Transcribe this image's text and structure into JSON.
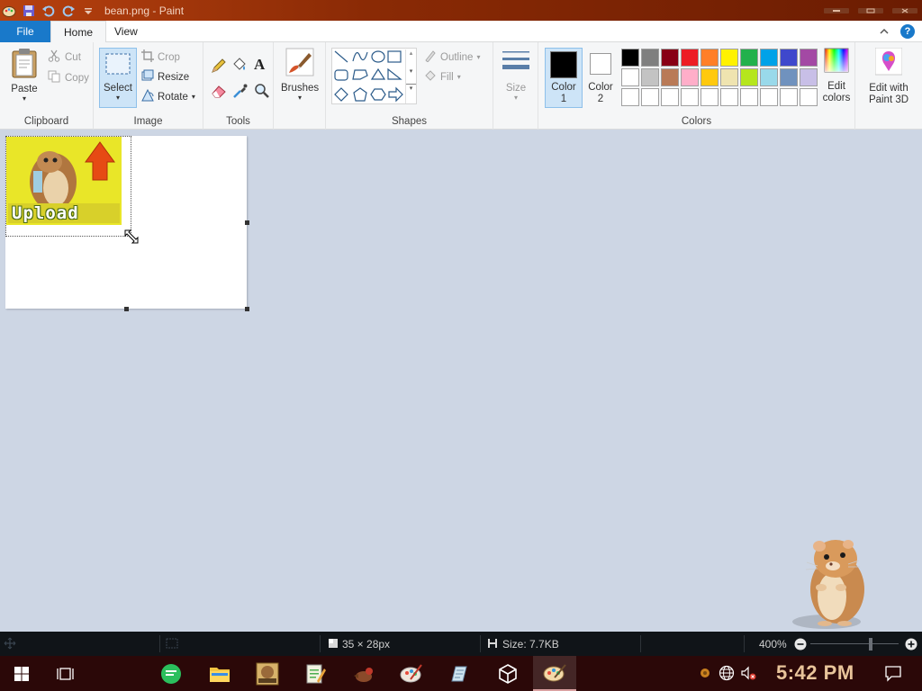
{
  "window": {
    "title": "bean.png - Paint"
  },
  "tabs": {
    "file": "File",
    "home": "Home",
    "view": "View"
  },
  "clipboard": {
    "paste": "Paste",
    "cut": "Cut",
    "copy": "Copy",
    "group": "Clipboard"
  },
  "image": {
    "select": "Select",
    "crop": "Crop",
    "resize": "Resize",
    "rotate": "Rotate",
    "group": "Image"
  },
  "tools": {
    "group": "Tools"
  },
  "brushes": {
    "label": "Brushes"
  },
  "shapes": {
    "outline": "Outline",
    "fill": "Fill",
    "group": "Shapes"
  },
  "size": {
    "label": "Size"
  },
  "colors": {
    "color1_line1": "Color",
    "color1_line2": "1",
    "color2_line1": "Color",
    "color2_line2": "2",
    "edit_line1": "Edit",
    "edit_line2": "colors",
    "group": "Colors",
    "palette": [
      "#000000",
      "#7f7f7f",
      "#880015",
      "#ed1c24",
      "#ff7f27",
      "#fff200",
      "#22b14c",
      "#00a2e8",
      "#3f48cc",
      "#a349a4",
      "#ffffff",
      "#c3c3c3",
      "#b97a57",
      "#ffaec9",
      "#ffc90e",
      "#efe4b0",
      "#b5e61d",
      "#99d9ea",
      "#7092be",
      "#c8bfe7",
      "#ffffff",
      "#ffffff",
      "#ffffff",
      "#ffffff",
      "#ffffff",
      "#ffffff",
      "#ffffff",
      "#ffffff",
      "#ffffff",
      "#ffffff"
    ],
    "active_color1": "#000000",
    "active_color2": "#ffffff"
  },
  "paint3d": {
    "line1": "Edit with",
    "line2": "Paint 3D"
  },
  "canvas_image": {
    "caption": "Upload"
  },
  "status": {
    "dimensions": "35 × 28px",
    "size": "Size: 7.7KB",
    "zoom": "400%"
  },
  "taskbar": {
    "time": "5:42 PM"
  }
}
